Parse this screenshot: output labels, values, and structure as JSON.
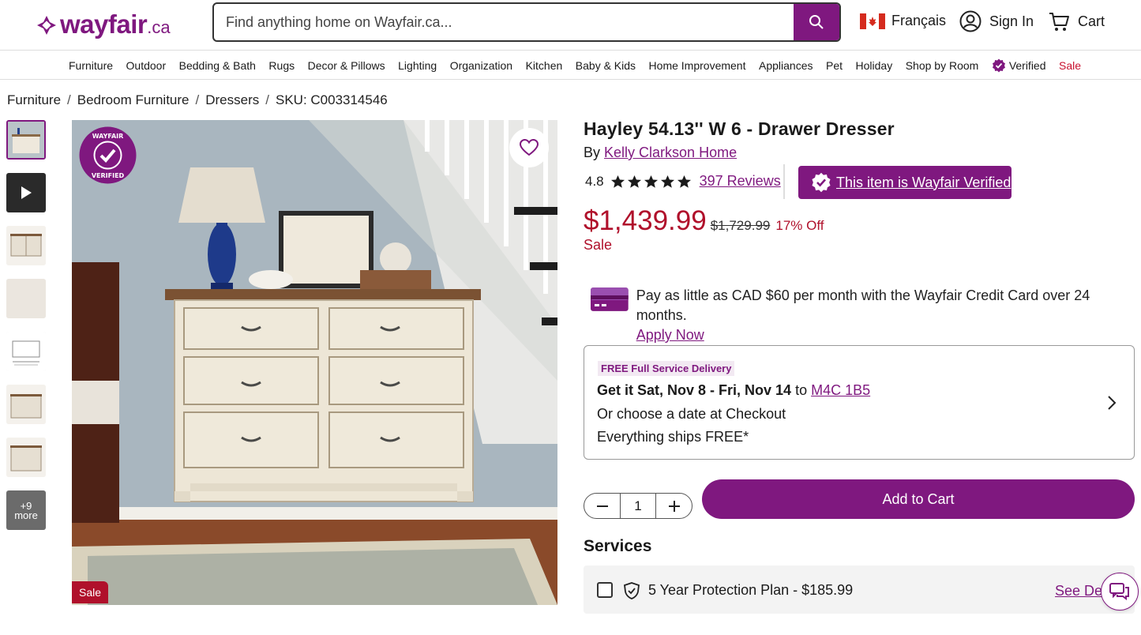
{
  "header": {
    "logo_word": "wayfair",
    "logo_suffix": ".ca",
    "search_placeholder": "Find anything home on Wayfair.ca...",
    "language": "Français",
    "sign_in": "Sign In",
    "cart": "Cart"
  },
  "nav": {
    "items": [
      "Furniture",
      "Outdoor",
      "Bedding & Bath",
      "Rugs",
      "Decor & Pillows",
      "Lighting",
      "Organization",
      "Kitchen",
      "Baby & Kids",
      "Home Improvement",
      "Appliances",
      "Pet",
      "Holiday",
      "Shop by Room"
    ],
    "verified": "Verified",
    "sale": "Sale"
  },
  "breadcrumb": {
    "items": [
      "Furniture",
      "Bedroom Furniture",
      "Dressers"
    ],
    "sku": "SKU: C003314546"
  },
  "gallery": {
    "more_count": "+9",
    "more_label": "more",
    "badge_text": "WAYFAIR VERIFIED",
    "sale_tag": "Sale"
  },
  "product": {
    "title": "Hayley 54.13'' W 6 - Drawer Dresser",
    "by_prefix": "By",
    "brand": "Kelly Clarkson Home",
    "rating": "4.8",
    "rating_value": 4.8,
    "reviews": "397 Reviews",
    "verified_label": "This item is Wayfair Verified",
    "price": "$1,439.99",
    "was_price": "$1,729.99",
    "discount": "17% Off",
    "sale_label": "Sale"
  },
  "credit": {
    "text": "Pay as little as CAD $60 per month with the Wayfair Credit Card over 24 months.",
    "apply": "Apply Now"
  },
  "delivery": {
    "tag": "FREE Full Service Delivery",
    "get_it": "Get it Sat, Nov 8 - Fri, Nov 14",
    "to": "to",
    "postal": "M4C 1B5",
    "line2": "Or choose a date at Checkout",
    "line3": "Everything ships FREE*"
  },
  "purchase": {
    "quantity": "1",
    "add_to_cart": "Add to Cart"
  },
  "services": {
    "heading": "Services",
    "plan": "5 Year Protection Plan - $185.99",
    "see_details": "See Det"
  },
  "colors": {
    "brand": "#7f187f",
    "sale": "#b0102b"
  }
}
